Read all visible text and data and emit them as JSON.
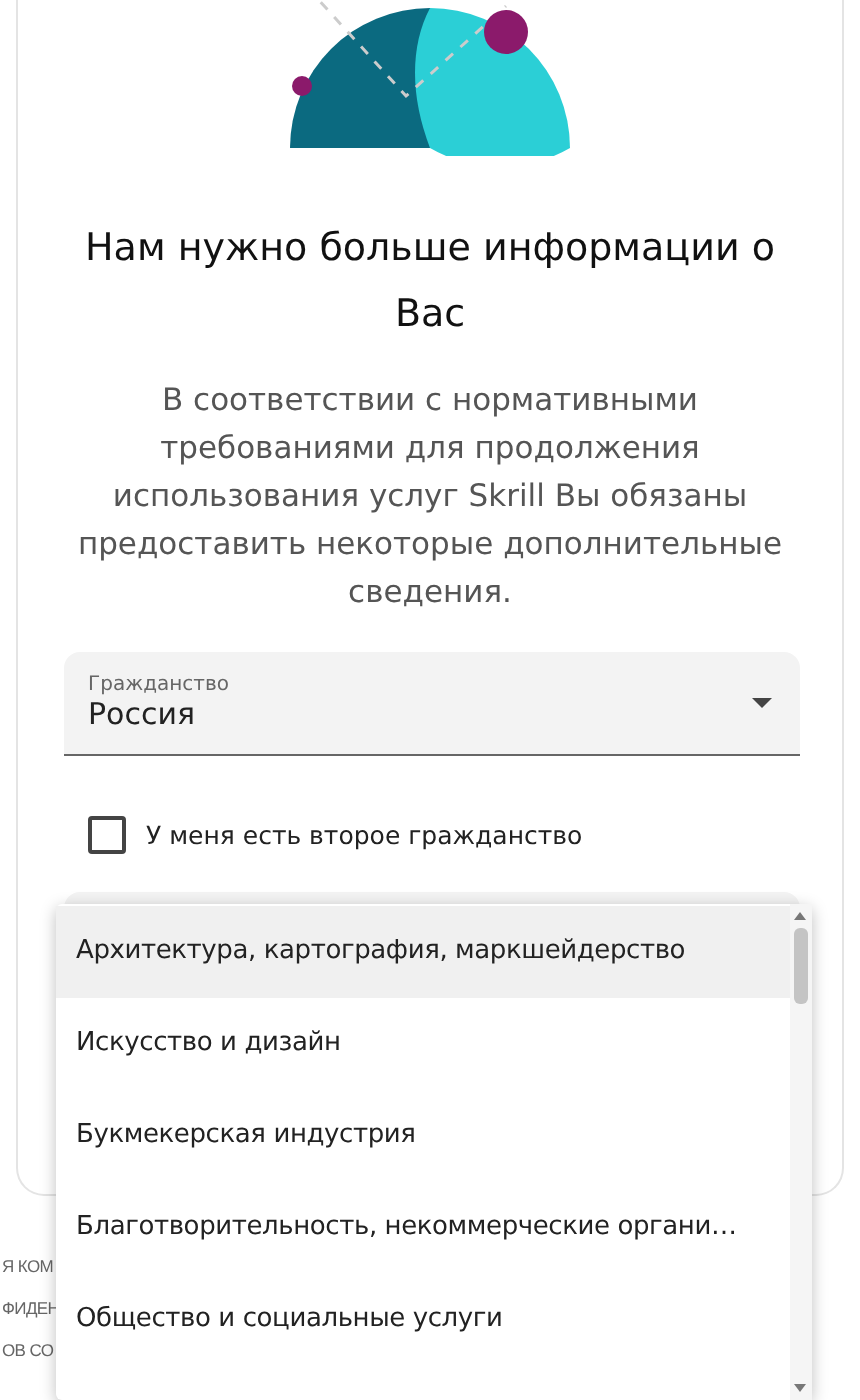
{
  "title": "Нам нужно больше информации о Вас",
  "description": "В соответствии с нормативными требованиями для продолжения использования услуг Skrill Вы обязаны предоставить некоторые дополнительные сведения.",
  "citizenship_field": {
    "label": "Гражданство",
    "value": "Россия"
  },
  "second_citizenship": {
    "label": "У меня есть второе гражданство",
    "checked": false
  },
  "footer_fragments": [
    "Я КОМ",
    "ФИДЕН",
    "ОВ СО"
  ],
  "dropdown_menu": {
    "items": [
      {
        "label": "Архитектура, картография, маркшейдерство",
        "selected": true
      },
      {
        "label": "Искусство и дизайн",
        "selected": false
      },
      {
        "label": "Букмекерская индустрия",
        "selected": false
      },
      {
        "label": "Благотворительность, некоммерческие органи…",
        "selected": false
      },
      {
        "label": "Общество и социальные услуги",
        "selected": false
      }
    ]
  }
}
